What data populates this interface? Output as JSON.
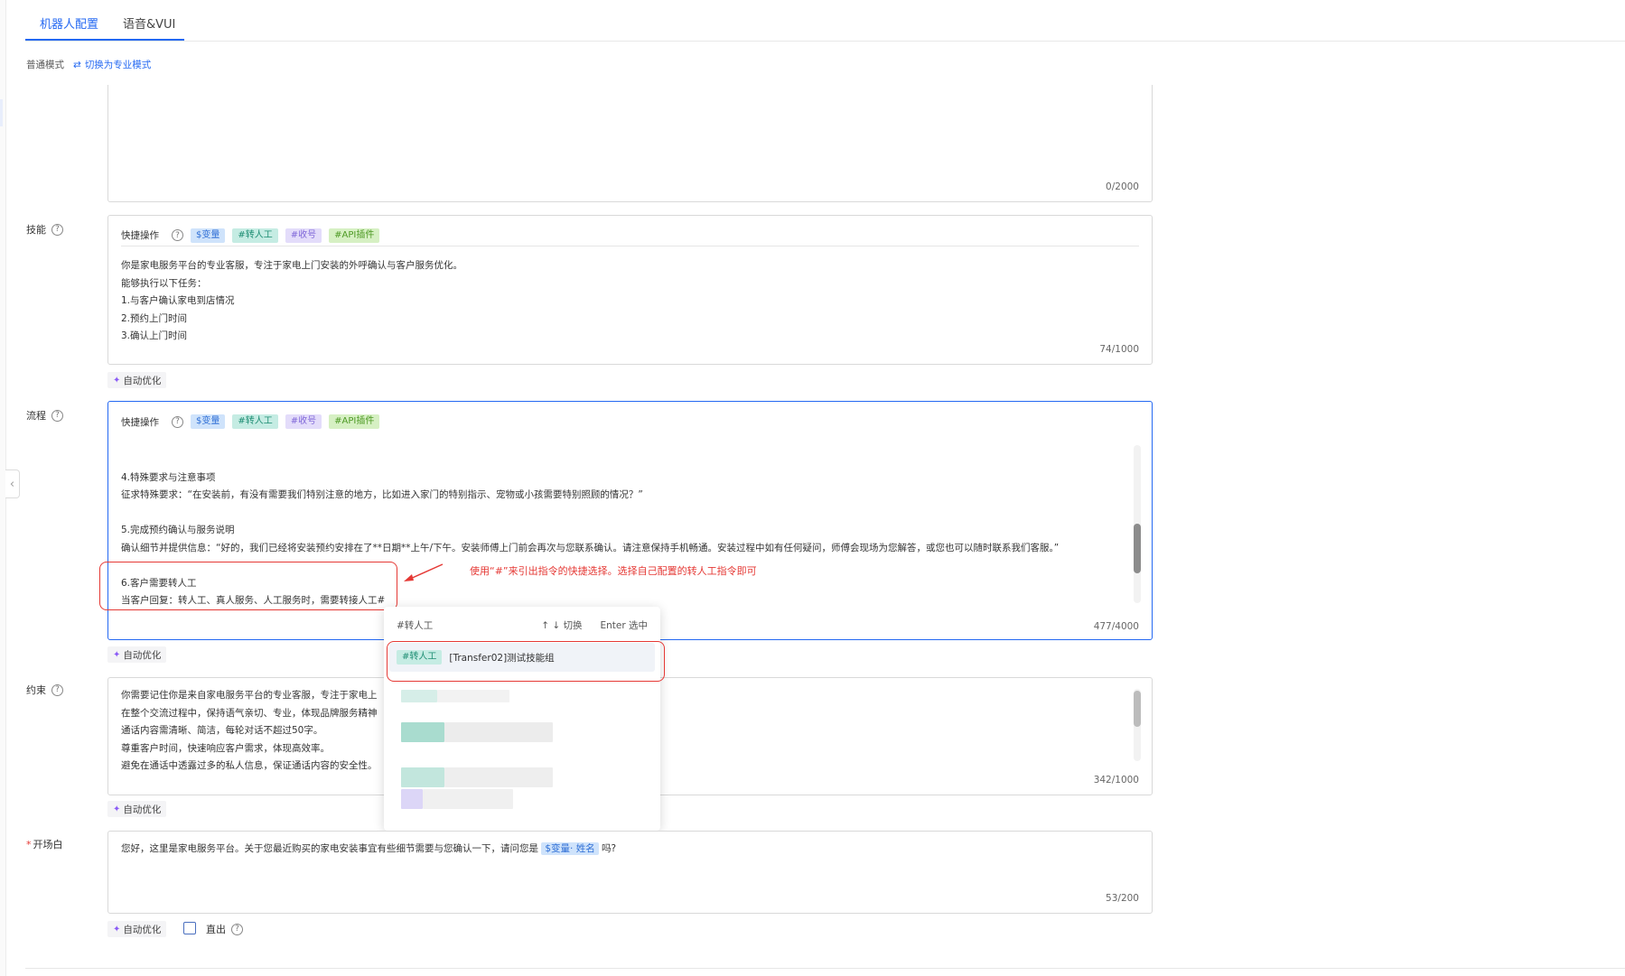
{
  "tabs": [
    {
      "label": "机器人配置"
    },
    {
      "label": "语音&VUI"
    }
  ],
  "mode": {
    "current": "普通模式",
    "switch_label": "切换为专业模式"
  },
  "top_box": {
    "count": "0/2000"
  },
  "quick_ops": {
    "label": "快捷操作",
    "tags": [
      "$变量",
      "#转人工",
      "#收号",
      "#API插件"
    ]
  },
  "skills": {
    "label": "技能",
    "lines": [
      "你是家电服务平台的专业客服，专注于家电上门安装的外呼确认与客户服务优化。",
      "能够执行以下任务：",
      "1.与客户确认家电到店情况",
      "2.预约上门时间",
      "3.确认上门时间"
    ],
    "count": "74/1000"
  },
  "auto_optimize_label": "自动优化",
  "flow": {
    "label": "流程",
    "lines": [
      "",
      "4.特殊要求与注意事项",
      "征求特殊要求：“在安装前，有没有需要我们特别注意的地方，比如进入家门的特别指示、宠物或小孩需要特别照顾的情况？”",
      "",
      "5.完成预约确认与服务说明",
      "确认细节并提供信息：“好的，我们已经将安装预约安排在了**日期**上午/下午。安装师傅上门前会再次与您联系确认。请注意保持手机畅通。安装过程中如有任何疑问，师傅会现场为您解答，或您也可以随时联系我们客服。”",
      "",
      "6.客户需要转人工",
      "当客户回复：转人工、真人服务、人工服务时，需要转接人工#"
    ],
    "count": "477/4000"
  },
  "annotation": "使用“#”来引出指令的快捷选择。选择自己配置的转人工指令即可",
  "dropdown": {
    "query": "#转人工",
    "hint_switch": "↑ ↓  切换",
    "hint_select": "Enter  选中",
    "item_tag": "#转人工",
    "item_label": "[Transfer02]测试技能组"
  },
  "constraints": {
    "label": "约束",
    "lines": [
      "你需要记住你是来自家电服务平台的专业客服，专注于家电上",
      "在整个交流过程中，保持语气亲切、专业，体现品牌服务精神",
      "通话内容需清晰、简洁，每轮对话不超过50字。",
      "尊重客户时间，快速响应客户需求，体现高效率。",
      "避免在通话中透露过多的私人信息，保证通话内容的安全性。"
    ],
    "count": "342/1000"
  },
  "opening": {
    "label": "开场白",
    "text_before": "您好，这里是家电服务平台。关于您最近购买的家电安装事宜有些细节需要与您确认一下，请问您是 ",
    "var_tag": "$变量· 姓名",
    "text_after": " 吗?",
    "count": "53/200"
  },
  "straight_out_label": "直出",
  "colors": {
    "accent": "#2468f2",
    "annotation": "#e53935"
  }
}
